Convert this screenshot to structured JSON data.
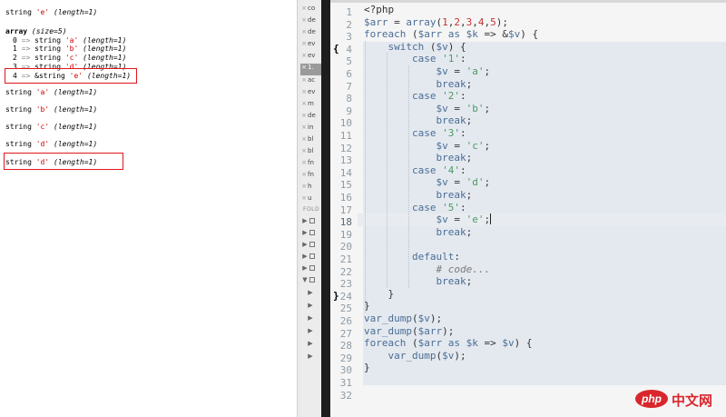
{
  "output": {
    "lines": [
      {
        "type": "str",
        "label": "string",
        "val": "'e'",
        "len": "(length=1)"
      },
      {
        "type": "array",
        "label": "array",
        "size": "(size=5)"
      },
      {
        "type": "item",
        "key": "0",
        "arrow": "=>",
        "label": "string",
        "val": "'a'",
        "len": "(length=1)"
      },
      {
        "type": "item",
        "key": "1",
        "arrow": "=>",
        "label": "string",
        "val": "'b'",
        "len": "(length=1)"
      },
      {
        "type": "item",
        "key": "2",
        "arrow": "=>",
        "label": "string",
        "val": "'c'",
        "len": "(length=1)"
      },
      {
        "type": "item",
        "key": "3",
        "arrow": "=>",
        "label": "string",
        "val": "'d'",
        "len": "(length=1)"
      },
      {
        "type": "item",
        "key": "4",
        "arrow": "=>",
        "label": "&string",
        "val": "'e'",
        "len": "(length=1)"
      },
      {
        "type": "str",
        "label": "string",
        "val": "'a'",
        "len": "(length=1)"
      },
      {
        "type": "str",
        "label": "string",
        "val": "'b'",
        "len": "(length=1)"
      },
      {
        "type": "str",
        "label": "string",
        "val": "'c'",
        "len": "(length=1)"
      },
      {
        "type": "str",
        "label": "string",
        "val": "'d'",
        "len": "(length=1)"
      },
      {
        "type": "str",
        "label": "string",
        "val": "'d'",
        "len": "(length=1)"
      }
    ]
  },
  "sidebar": {
    "open_files": [
      {
        "label": "co",
        "active": false
      },
      {
        "label": "de",
        "active": false
      },
      {
        "label": "de",
        "active": false
      },
      {
        "label": "ev",
        "active": false
      },
      {
        "label": "ev",
        "active": false
      },
      {
        "label": "1.",
        "active": true
      },
      {
        "label": "ac",
        "active": false
      },
      {
        "label": "ev",
        "active": false
      },
      {
        "label": "m",
        "active": false
      },
      {
        "label": "de",
        "active": false
      },
      {
        "label": "in",
        "active": false
      },
      {
        "label": "bl",
        "active": false
      },
      {
        "label": "bl",
        "active": false
      },
      {
        "label": "fn",
        "active": false
      },
      {
        "label": "fn",
        "active": false
      },
      {
        "label": "h",
        "active": false
      },
      {
        "label": "u",
        "active": false
      }
    ],
    "folders_header": "FOLD",
    "folders": [
      {
        "expanded": false,
        "child": false
      },
      {
        "expanded": false,
        "child": false
      },
      {
        "expanded": false,
        "child": false
      },
      {
        "expanded": false,
        "child": false
      },
      {
        "expanded": false,
        "child": false
      },
      {
        "expanded": true,
        "child": false
      },
      {
        "expanded": false,
        "child": true
      },
      {
        "expanded": false,
        "child": true
      },
      {
        "expanded": false,
        "child": true
      },
      {
        "expanded": false,
        "child": true
      },
      {
        "expanded": false,
        "child": true
      },
      {
        "expanded": false,
        "child": true
      }
    ]
  },
  "editor": {
    "current_line": 18,
    "code": [
      "<?php",
      "$arr = array(1,2,3,4,5);",
      "foreach ($arr as $k => &$v) {",
      "    switch ($v) {",
      "        case '1':",
      "            $v = 'a';",
      "            break;",
      "        case '2':",
      "            $v = 'b';",
      "            break;",
      "        case '3':",
      "            $v = 'c';",
      "            break;",
      "        case '4':",
      "            $v = 'd';",
      "            break;",
      "        case '5':",
      "            $v = 'e';",
      "            break;",
      "",
      "        default:",
      "            # code...",
      "            break;",
      "    }",
      "}",
      "var_dump($v);",
      "var_dump($arr);",
      "foreach ($arr as $k => $v) {",
      "    var_dump($v);",
      "}",
      "",
      ""
    ]
  },
  "watermark": {
    "badge": "php",
    "text": "中文网",
    "color": "#d9262d"
  }
}
